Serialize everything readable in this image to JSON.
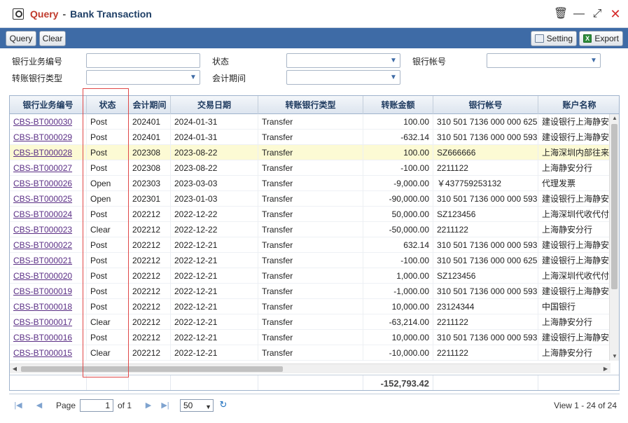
{
  "window": {
    "title_main": "Query",
    "title_sep": "-",
    "title_sub": "Bank Transaction",
    "delete_glyph": "🗑",
    "minimize_glyph": "—",
    "maximize_glyph": "⤢",
    "close_glyph": "✕"
  },
  "toolbar": {
    "query_label": "Query",
    "clear_label": "Clear",
    "setting_label": "Setting",
    "export_label": "Export",
    "export_icon_glyph": "X"
  },
  "filters": {
    "bank_biz_no_label": "银行业务编号",
    "status_label": "状态",
    "bank_account_label": "银行帐号",
    "transfer_type_label": "转账银行类型",
    "period_label": "会计期间"
  },
  "grid": {
    "columns": [
      "银行业务编号",
      "状态",
      "会计期间",
      "交易日期",
      "转账银行类型",
      "转账金额",
      "银行帐号",
      "账户名称"
    ],
    "rows": [
      {
        "id": "CBS-BT000030",
        "status": "Post",
        "period": "202401",
        "date": "2024-01-31",
        "type": "Transfer",
        "amount": "100.00",
        "account": "310 501 7136 000 000 625",
        "name": "建设银行上海静安"
      },
      {
        "id": "CBS-BT000029",
        "status": "Post",
        "period": "202401",
        "date": "2024-01-31",
        "type": "Transfer",
        "amount": "-632.14",
        "account": "310 501 7136 000 000 593",
        "name": "建设银行上海静安"
      },
      {
        "id": "CBS-BT000028",
        "status": "Post",
        "period": "202308",
        "date": "2023-08-22",
        "type": "Transfer",
        "amount": "100.00",
        "account": "SZ666666",
        "name": "上海深圳内部往来"
      },
      {
        "id": "CBS-BT000027",
        "status": "Post",
        "period": "202308",
        "date": "2023-08-22",
        "type": "Transfer",
        "amount": "-100.00",
        "account": "2211122",
        "name": "上海静安分行"
      },
      {
        "id": "CBS-BT000026",
        "status": "Open",
        "period": "202303",
        "date": "2023-03-03",
        "type": "Transfer",
        "amount": "-9,000.00",
        "account": "￥437759253132",
        "name": "代理发票"
      },
      {
        "id": "CBS-BT000025",
        "status": "Open",
        "period": "202301",
        "date": "2023-01-03",
        "type": "Transfer",
        "amount": "-90,000.00",
        "account": "310 501 7136 000 000 593",
        "name": "建设银行上海静安"
      },
      {
        "id": "CBS-BT000024",
        "status": "Post",
        "period": "202212",
        "date": "2022-12-22",
        "type": "Transfer",
        "amount": "50,000.00",
        "account": "SZ123456",
        "name": "上海深圳代收代付"
      },
      {
        "id": "CBS-BT000023",
        "status": "Clear",
        "period": "202212",
        "date": "2022-12-22",
        "type": "Transfer",
        "amount": "-50,000.00",
        "account": "2211122",
        "name": "上海静安分行"
      },
      {
        "id": "CBS-BT000022",
        "status": "Post",
        "period": "202212",
        "date": "2022-12-21",
        "type": "Transfer",
        "amount": "632.14",
        "account": "310 501 7136 000 000 593",
        "name": "建设银行上海静安"
      },
      {
        "id": "CBS-BT000021",
        "status": "Post",
        "period": "202212",
        "date": "2022-12-21",
        "type": "Transfer",
        "amount": "-100.00",
        "account": "310 501 7136 000 000 625",
        "name": "建设银行上海静安"
      },
      {
        "id": "CBS-BT000020",
        "status": "Post",
        "period": "202212",
        "date": "2022-12-21",
        "type": "Transfer",
        "amount": "1,000.00",
        "account": "SZ123456",
        "name": "上海深圳代收代付"
      },
      {
        "id": "CBS-BT000019",
        "status": "Post",
        "period": "202212",
        "date": "2022-12-21",
        "type": "Transfer",
        "amount": "-1,000.00",
        "account": "310 501 7136 000 000 593",
        "name": "建设银行上海静安"
      },
      {
        "id": "CBS-BT000018",
        "status": "Post",
        "period": "202212",
        "date": "2022-12-21",
        "type": "Transfer",
        "amount": "10,000.00",
        "account": "23124344",
        "name": "中国银行"
      },
      {
        "id": "CBS-BT000017",
        "status": "Clear",
        "period": "202212",
        "date": "2022-12-21",
        "type": "Transfer",
        "amount": "-63,214.00",
        "account": "2211122",
        "name": "上海静安分行"
      },
      {
        "id": "CBS-BT000016",
        "status": "Post",
        "period": "202212",
        "date": "2022-12-21",
        "type": "Transfer",
        "amount": "10,000.00",
        "account": "310 501 7136 000 000 593",
        "name": "建设银行上海静安"
      },
      {
        "id": "CBS-BT000015",
        "status": "Clear",
        "period": "202212",
        "date": "2022-12-21",
        "type": "Transfer",
        "amount": "-10,000.00",
        "account": "2211122",
        "name": "上海静安分行"
      }
    ],
    "total_amount": "-152,793.42"
  },
  "pager": {
    "first_glyph": "|◀",
    "prev_glyph": "◀",
    "next_glyph": "▶",
    "last_glyph": "▶|",
    "page_label": "Page",
    "current_page": "1",
    "of_label": "of 1",
    "page_size": "50",
    "refresh_glyph": "↻",
    "view_info": "View 1 - 24 of 24"
  }
}
